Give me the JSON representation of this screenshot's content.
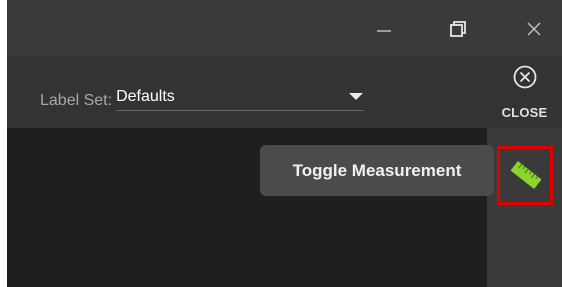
{
  "window": {
    "minimize_icon": "minimize-icon",
    "restore_icon": "restore-icon",
    "close_icon": "close-icon"
  },
  "label_set": {
    "caption": "Label Set:",
    "value": "Defaults",
    "caret_icon": "caret-down-icon"
  },
  "close_panel": {
    "label": "CLOSE",
    "icon": "close-circle-icon"
  },
  "tooltip": {
    "text": "Toggle Measurement"
  },
  "measurement": {
    "icon": "ruler-icon",
    "icon_color": "#8bd42c",
    "highlight_color": "#e00000"
  }
}
